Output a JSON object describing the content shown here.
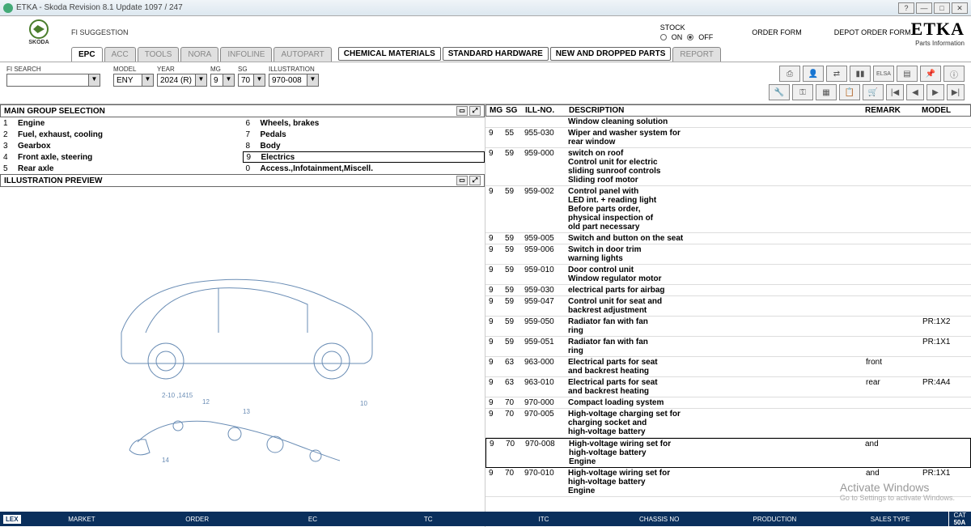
{
  "window": {
    "title": "ETKA - Skoda Revision 8.1 Update 1097 / 247"
  },
  "brand": {
    "name": "SKODA",
    "logo_alt": "skoda-logo"
  },
  "fi_suggestion": "FI SUGGESTION",
  "stock": {
    "label": "STOCK",
    "on": "ON",
    "off": "OFF"
  },
  "order_form": "ORDER FORM",
  "depot_order_form": "DEPOT ORDER FORM",
  "etka": {
    "big": "ETKA",
    "sub": "Parts Information"
  },
  "tabs": {
    "epc": "EPC",
    "acc": "ACC",
    "tools": "TOOLS",
    "nora": "NORA",
    "infoline": "INFOLINE",
    "autopart": "AUTOPART",
    "chem": "CHEMICAL MATERIALS",
    "std": "STANDARD HARDWARE",
    "newdrop": "NEW AND DROPPED PARTS",
    "report": "REPORT"
  },
  "search": {
    "fi_search": "FI SEARCH",
    "model_lbl": "MODEL",
    "model": "ENY",
    "year_lbl": "YEAR",
    "year": "2024 (R)",
    "mg_lbl": "MG",
    "mg": "9",
    "sg_lbl": "SG",
    "sg": "70",
    "ill_lbl": "ILLUSTRATION",
    "ill": "970-008"
  },
  "main_group_hdr": "MAIN GROUP SELECTION",
  "groups_left": [
    {
      "n": "1",
      "t": "Engine"
    },
    {
      "n": "2",
      "t": "Fuel, exhaust, cooling"
    },
    {
      "n": "3",
      "t": "Gearbox"
    },
    {
      "n": "4",
      "t": "Front axle, steering"
    },
    {
      "n": "5",
      "t": "Rear axle"
    }
  ],
  "groups_right": [
    {
      "n": "6",
      "t": "Wheels, brakes"
    },
    {
      "n": "7",
      "t": "Pedals"
    },
    {
      "n": "8",
      "t": "Body"
    },
    {
      "n": "9",
      "t": "Electrics",
      "sel": true
    },
    {
      "n": "0",
      "t": "Access.,Infotainment,Miscell."
    }
  ],
  "illus_hdr": "ILLUSTRATION PREVIEW",
  "parts_hdr": {
    "mg": "MG",
    "sg": "SG",
    "ill": "ILL-NO.",
    "desc": "DESCRIPTION",
    "remark": "REMARK",
    "model": "MODEL"
  },
  "parts": [
    {
      "mg": "",
      "sg": "",
      "ill": "",
      "desc": [
        "Window cleaning solution"
      ],
      "remark": "",
      "model": ""
    },
    {
      "mg": "9",
      "sg": "55",
      "ill": "955-030",
      "desc": [
        "Wiper and washer system for",
        "rear window"
      ],
      "remark": "",
      "model": ""
    },
    {
      "mg": "9",
      "sg": "59",
      "ill": "959-000",
      "desc": [
        "switch on roof",
        "Control unit for electric",
        "sliding sunroof controls",
        "Sliding roof motor"
      ],
      "remark": "",
      "model": ""
    },
    {
      "mg": "9",
      "sg": "59",
      "ill": "959-002",
      "desc": [
        "Control panel with",
        "LED int. + reading light",
        "Before parts order,",
        "physical inspection of",
        "old part necessary"
      ],
      "remark": "",
      "model": ""
    },
    {
      "mg": "9",
      "sg": "59",
      "ill": "959-005",
      "desc": [
        "Switch and button on the seat"
      ],
      "remark": "",
      "model": ""
    },
    {
      "mg": "9",
      "sg": "59",
      "ill": "959-006",
      "desc": [
        "Switch in door trim",
        "warning lights"
      ],
      "remark": "",
      "model": ""
    },
    {
      "mg": "9",
      "sg": "59",
      "ill": "959-010",
      "desc": [
        "Door control unit",
        "Window regulator motor"
      ],
      "remark": "",
      "model": ""
    },
    {
      "mg": "9",
      "sg": "59",
      "ill": "959-030",
      "desc": [
        "electrical parts for airbag"
      ],
      "remark": "",
      "model": ""
    },
    {
      "mg": "9",
      "sg": "59",
      "ill": "959-047",
      "desc": [
        "Control unit for seat and",
        "backrest adjustment"
      ],
      "remark": "",
      "model": ""
    },
    {
      "mg": "9",
      "sg": "59",
      "ill": "959-050",
      "desc": [
        "Radiator fan with fan",
        "ring"
      ],
      "remark": "",
      "model": "PR:1X2"
    },
    {
      "mg": "9",
      "sg": "59",
      "ill": "959-051",
      "desc": [
        "Radiator fan with fan",
        "ring"
      ],
      "remark": "",
      "model": "PR:1X1"
    },
    {
      "mg": "9",
      "sg": "63",
      "ill": "963-000",
      "desc": [
        "Electrical parts for seat",
        "and backrest heating"
      ],
      "remark": "front",
      "model": ""
    },
    {
      "mg": "9",
      "sg": "63",
      "ill": "963-010",
      "desc": [
        "Electrical parts for seat",
        "and backrest heating"
      ],
      "remark": "rear",
      "model": "PR:4A4"
    },
    {
      "mg": "9",
      "sg": "70",
      "ill": "970-000",
      "desc": [
        "Compact loading system"
      ],
      "remark": "",
      "model": ""
    },
    {
      "mg": "9",
      "sg": "70",
      "ill": "970-005",
      "desc": [
        "High-voltage charging set for",
        "charging socket and",
        "high-voltage battery"
      ],
      "remark": "",
      "model": ""
    },
    {
      "mg": "9",
      "sg": "70",
      "ill": "970-008",
      "desc": [
        "High-voltage wiring set for",
        "high-voltage battery",
        "Engine"
      ],
      "remark": "and",
      "model": "",
      "sel": true
    },
    {
      "mg": "9",
      "sg": "70",
      "ill": "970-010",
      "desc": [
        "High-voltage wiring set for",
        "high-voltage battery",
        "Engine"
      ],
      "remark": "and",
      "model": "PR:1X1"
    }
  ],
  "footer": {
    "lex": "LEX",
    "market": "MARKET",
    "order": "ORDER",
    "ec": "EC",
    "tc": "TC",
    "itc": "ITC",
    "chassis": "CHASSIS NO",
    "production": "PRODUCTION",
    "sales": "SALES TYPE",
    "cat": "CAT",
    "catv": "50A"
  },
  "watermark": {
    "t1": "Activate Windows",
    "t2": "Go to Settings to activate Windows."
  }
}
